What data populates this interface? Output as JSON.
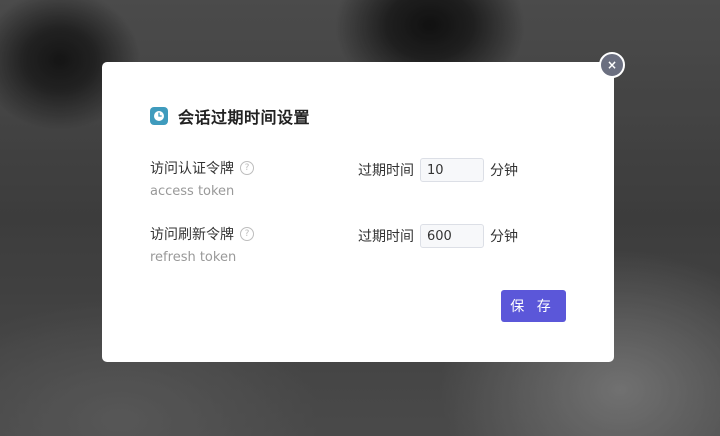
{
  "dialog": {
    "title": "会话过期时间设置",
    "close_glyph": "×",
    "save_label": "保 存"
  },
  "rows": [
    {
      "label": "访问认证令牌",
      "sublabel": "access token",
      "field_label": "过期时间",
      "value": "10",
      "unit": "分钟"
    },
    {
      "label": "访问刷新令牌",
      "sublabel": "refresh token",
      "field_label": "过期时间",
      "value": "600",
      "unit": "分钟"
    }
  ],
  "help_glyph": "?",
  "colors": {
    "accent": "#5b57d9",
    "header_icon": "#3f9bbd",
    "close_button": "#6b6f80"
  }
}
